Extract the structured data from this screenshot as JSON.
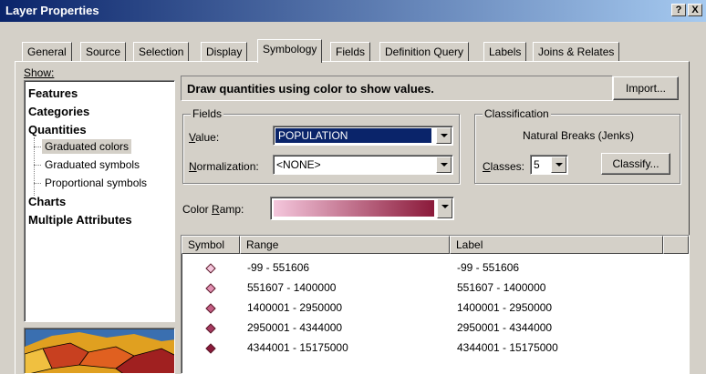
{
  "window": {
    "title": "Layer Properties",
    "help_label": "?",
    "close_label": "X"
  },
  "tabs": [
    {
      "label": "General"
    },
    {
      "label": "Source"
    },
    {
      "label": "Selection"
    },
    {
      "label": "Display"
    },
    {
      "label": "Symbology",
      "active": true
    },
    {
      "label": "Fields"
    },
    {
      "label": "Definition Query"
    },
    {
      "label": "Labels"
    },
    {
      "label": "Joins & Relates"
    }
  ],
  "show": {
    "label": "Show:",
    "items": [
      {
        "label": "Features"
      },
      {
        "label": "Categories"
      },
      {
        "label": "Quantities"
      },
      {
        "label": "Graduated colors"
      },
      {
        "label": "Graduated symbols"
      },
      {
        "label": "Proportional symbols"
      },
      {
        "label": "Charts"
      },
      {
        "label": "Multiple Attributes"
      }
    ]
  },
  "header": {
    "description": "Draw quantities using color to show values.",
    "import_label": "Import..."
  },
  "fields": {
    "group_label": "Fields",
    "value_label": "Value:",
    "value": "POPULATION",
    "normalization_label": "Normalization:",
    "normalization": "<NONE>"
  },
  "classification": {
    "group_label": "Classification",
    "method": "Natural Breaks (Jenks)",
    "classes_label": "Classes:",
    "classes_value": "5",
    "classify_label": "Classify..."
  },
  "color_ramp": {
    "label": "Color Ramp:",
    "start_color": "#f4c6dc",
    "end_color": "#8b1a3a"
  },
  "table": {
    "headers": {
      "symbol": "Symbol",
      "range": "Range",
      "label": "Label"
    },
    "rows": [
      {
        "color": "#f4c6dc",
        "range": "-99 - 551606",
        "label": "-99 - 551606"
      },
      {
        "color": "#e290b2",
        "range": "551607 - 1400000",
        "label": "551607 - 1400000"
      },
      {
        "color": "#c45e84",
        "range": "1400001 - 2950000",
        "label": "1400001 - 2950000"
      },
      {
        "color": "#a63a60",
        "range": "2950001 - 4344000",
        "label": "2950001 - 4344000"
      },
      {
        "color": "#8b1a3a",
        "range": "4344001 - 15175000",
        "label": "4344001 - 15175000"
      }
    ]
  }
}
